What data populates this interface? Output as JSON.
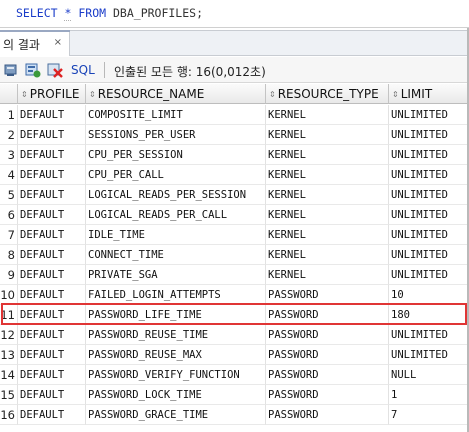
{
  "editor": {
    "kw_select": "SELECT",
    "star": "*",
    "kw_from": "FROM",
    "table": "DBA_PROFILES;"
  },
  "result_tab": {
    "label": "의 결과",
    "close": "×"
  },
  "toolbar": {
    "icons": [
      "pin-icon",
      "refresh-icon",
      "delete-icon"
    ],
    "sql_label": "SQL",
    "status": "인출된 모든 행: 16(0,012초)"
  },
  "grid": {
    "columns": [
      "PROFILE",
      "RESOURCE_NAME",
      "RESOURCE_TYPE",
      "LIMIT"
    ],
    "rows": [
      {
        "n": "1",
        "profile": "DEFAULT",
        "name": "COMPOSITE_LIMIT",
        "type": "KERNEL",
        "limit": "UNLIMITED"
      },
      {
        "n": "2",
        "profile": "DEFAULT",
        "name": "SESSIONS_PER_USER",
        "type": "KERNEL",
        "limit": "UNLIMITED"
      },
      {
        "n": "3",
        "profile": "DEFAULT",
        "name": "CPU_PER_SESSION",
        "type": "KERNEL",
        "limit": "UNLIMITED"
      },
      {
        "n": "4",
        "profile": "DEFAULT",
        "name": "CPU_PER_CALL",
        "type": "KERNEL",
        "limit": "UNLIMITED"
      },
      {
        "n": "5",
        "profile": "DEFAULT",
        "name": "LOGICAL_READS_PER_SESSION",
        "type": "KERNEL",
        "limit": "UNLIMITED"
      },
      {
        "n": "6",
        "profile": "DEFAULT",
        "name": "LOGICAL_READS_PER_CALL",
        "type": "KERNEL",
        "limit": "UNLIMITED"
      },
      {
        "n": "7",
        "profile": "DEFAULT",
        "name": "IDLE_TIME",
        "type": "KERNEL",
        "limit": "UNLIMITED"
      },
      {
        "n": "8",
        "profile": "DEFAULT",
        "name": "CONNECT_TIME",
        "type": "KERNEL",
        "limit": "UNLIMITED"
      },
      {
        "n": "9",
        "profile": "DEFAULT",
        "name": "PRIVATE_SGA",
        "type": "KERNEL",
        "limit": "UNLIMITED"
      },
      {
        "n": "10",
        "profile": "DEFAULT",
        "name": "FAILED_LOGIN_ATTEMPTS",
        "type": "PASSWORD",
        "limit": "10"
      },
      {
        "n": "11",
        "profile": "DEFAULT",
        "name": "PASSWORD_LIFE_TIME",
        "type": "PASSWORD",
        "limit": "180"
      },
      {
        "n": "12",
        "profile": "DEFAULT",
        "name": "PASSWORD_REUSE_TIME",
        "type": "PASSWORD",
        "limit": "UNLIMITED"
      },
      {
        "n": "13",
        "profile": "DEFAULT",
        "name": "PASSWORD_REUSE_MAX",
        "type": "PASSWORD",
        "limit": "UNLIMITED"
      },
      {
        "n": "14",
        "profile": "DEFAULT",
        "name": "PASSWORD_VERIFY_FUNCTION",
        "type": "PASSWORD",
        "limit": "NULL"
      },
      {
        "n": "15",
        "profile": "DEFAULT",
        "name": "PASSWORD_LOCK_TIME",
        "type": "PASSWORD",
        "limit": "1"
      },
      {
        "n": "16",
        "profile": "DEFAULT",
        "name": "PASSWORD_GRACE_TIME",
        "type": "PASSWORD",
        "limit": "7"
      }
    ],
    "highlighted_row": "11",
    "highlight_color": "#e03535"
  }
}
